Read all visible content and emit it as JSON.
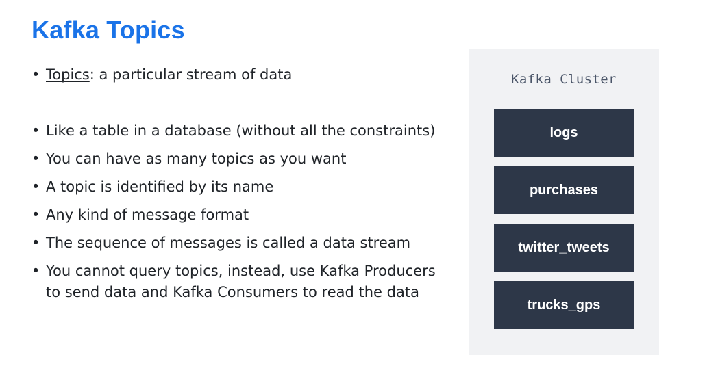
{
  "slide": {
    "title": "Kafka Topics"
  },
  "bullets": {
    "b1_underlined": "Topics",
    "b1_rest": ": a particular stream of data",
    "b2": "Like a table in a database (without all the constraints)",
    "b3": "You can have as many topics as you want",
    "b4_pre": "A topic is identified by its ",
    "b4_underlined": "name",
    "b5": "Any kind of message format",
    "b6_pre": "The sequence of messages is called a ",
    "b6_underlined": "data stream",
    "b7_line1": "You cannot query topics, instead, use Kafka Producers",
    "b7_line2": "to send data and Kafka Consumers to read the data"
  },
  "cluster": {
    "label": "Kafka Cluster",
    "topics": [
      "logs",
      "purchases",
      "twitter_tweets",
      "trucks_gps"
    ]
  },
  "colors": {
    "title": "#1a73e8",
    "topic_box": "#2d3748",
    "cluster_bg": "#f1f2f4"
  }
}
